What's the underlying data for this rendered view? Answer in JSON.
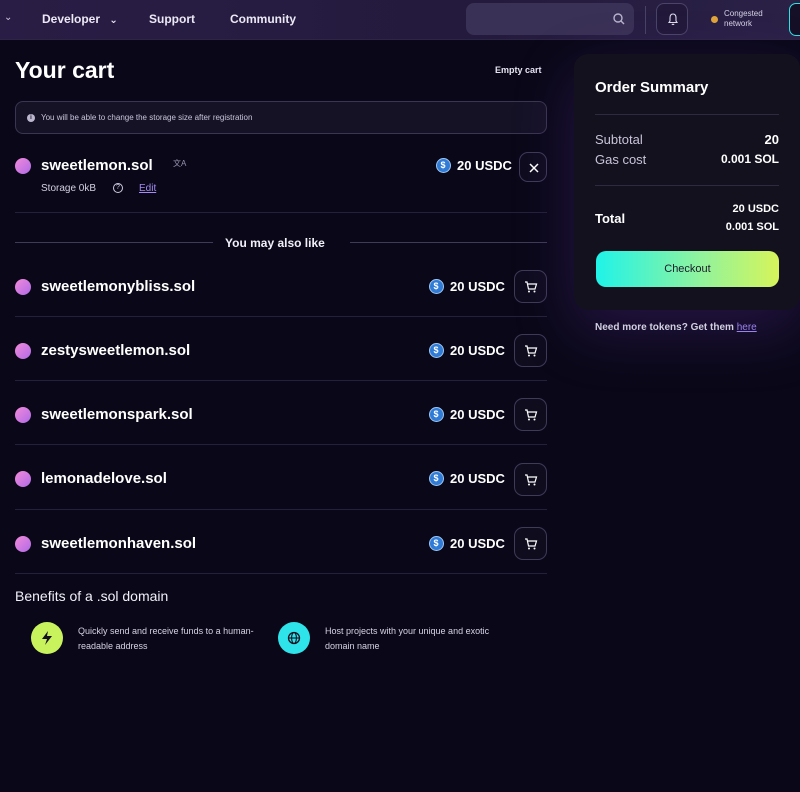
{
  "nav": {
    "developer": "Developer",
    "support": "Support",
    "community": "Community",
    "network_status": "Congested network"
  },
  "cart": {
    "title": "Your cart",
    "empty_label": "Empty cart",
    "notice": "You will be able to change the storage size after registration",
    "item": {
      "name": "sweetlemon.sol",
      "price": "20 USDC",
      "storage": "Storage 0kB",
      "edit": "Edit"
    }
  },
  "suggestions": {
    "heading": "You may also like",
    "items": [
      {
        "name": "sweetlemonybliss.sol",
        "price": "20 USDC"
      },
      {
        "name": "zestysweetlemon.sol",
        "price": "20 USDC"
      },
      {
        "name": "sweetlemonspark.sol",
        "price": "20 USDC"
      },
      {
        "name": "lemonadelove.sol",
        "price": "20 USDC"
      },
      {
        "name": "sweetlemonhaven.sol",
        "price": "20 USDC"
      }
    ]
  },
  "benefits": {
    "title": "Benefits of a .sol domain",
    "items": [
      {
        "text": "Quickly send and receive funds to a human-readable address",
        "icon": "lightning-icon"
      },
      {
        "text": "Host projects with your unique and exotic domain name",
        "icon": "globe-icon"
      }
    ]
  },
  "summary": {
    "title": "Order Summary",
    "subtotal_label": "Subtotal",
    "subtotal_value": "20",
    "gas_label": "Gas cost",
    "gas_value": "0.001 SOL",
    "total_label": "Total",
    "total_usdc": "20 USDC",
    "total_sol": "0.001 SOL",
    "checkout": "Checkout",
    "more_tokens": "Need more tokens? Get them",
    "more_tokens_link": "here"
  },
  "colors": {
    "background": "#0a0818",
    "accent_link": "#a48cf2",
    "checkout_gradient_start": "#1ff3e8",
    "checkout_gradient_end": "#d6f45a"
  }
}
